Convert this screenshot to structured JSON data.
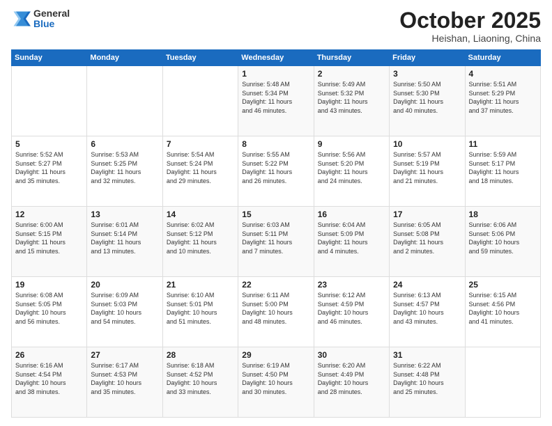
{
  "logo": {
    "general": "General",
    "blue": "Blue"
  },
  "header": {
    "month": "October 2025",
    "location": "Heishan, Liaoning, China"
  },
  "days_of_week": [
    "Sunday",
    "Monday",
    "Tuesday",
    "Wednesday",
    "Thursday",
    "Friday",
    "Saturday"
  ],
  "weeks": [
    [
      {
        "day": null,
        "info": null
      },
      {
        "day": null,
        "info": null
      },
      {
        "day": null,
        "info": null
      },
      {
        "day": "1",
        "info": "Sunrise: 5:48 AM\nSunset: 5:34 PM\nDaylight: 11 hours\nand 46 minutes."
      },
      {
        "day": "2",
        "info": "Sunrise: 5:49 AM\nSunset: 5:32 PM\nDaylight: 11 hours\nand 43 minutes."
      },
      {
        "day": "3",
        "info": "Sunrise: 5:50 AM\nSunset: 5:30 PM\nDaylight: 11 hours\nand 40 minutes."
      },
      {
        "day": "4",
        "info": "Sunrise: 5:51 AM\nSunset: 5:29 PM\nDaylight: 11 hours\nand 37 minutes."
      }
    ],
    [
      {
        "day": "5",
        "info": "Sunrise: 5:52 AM\nSunset: 5:27 PM\nDaylight: 11 hours\nand 35 minutes."
      },
      {
        "day": "6",
        "info": "Sunrise: 5:53 AM\nSunset: 5:25 PM\nDaylight: 11 hours\nand 32 minutes."
      },
      {
        "day": "7",
        "info": "Sunrise: 5:54 AM\nSunset: 5:24 PM\nDaylight: 11 hours\nand 29 minutes."
      },
      {
        "day": "8",
        "info": "Sunrise: 5:55 AM\nSunset: 5:22 PM\nDaylight: 11 hours\nand 26 minutes."
      },
      {
        "day": "9",
        "info": "Sunrise: 5:56 AM\nSunset: 5:20 PM\nDaylight: 11 hours\nand 24 minutes."
      },
      {
        "day": "10",
        "info": "Sunrise: 5:57 AM\nSunset: 5:19 PM\nDaylight: 11 hours\nand 21 minutes."
      },
      {
        "day": "11",
        "info": "Sunrise: 5:59 AM\nSunset: 5:17 PM\nDaylight: 11 hours\nand 18 minutes."
      }
    ],
    [
      {
        "day": "12",
        "info": "Sunrise: 6:00 AM\nSunset: 5:15 PM\nDaylight: 11 hours\nand 15 minutes."
      },
      {
        "day": "13",
        "info": "Sunrise: 6:01 AM\nSunset: 5:14 PM\nDaylight: 11 hours\nand 13 minutes."
      },
      {
        "day": "14",
        "info": "Sunrise: 6:02 AM\nSunset: 5:12 PM\nDaylight: 11 hours\nand 10 minutes."
      },
      {
        "day": "15",
        "info": "Sunrise: 6:03 AM\nSunset: 5:11 PM\nDaylight: 11 hours\nand 7 minutes."
      },
      {
        "day": "16",
        "info": "Sunrise: 6:04 AM\nSunset: 5:09 PM\nDaylight: 11 hours\nand 4 minutes."
      },
      {
        "day": "17",
        "info": "Sunrise: 6:05 AM\nSunset: 5:08 PM\nDaylight: 11 hours\nand 2 minutes."
      },
      {
        "day": "18",
        "info": "Sunrise: 6:06 AM\nSunset: 5:06 PM\nDaylight: 10 hours\nand 59 minutes."
      }
    ],
    [
      {
        "day": "19",
        "info": "Sunrise: 6:08 AM\nSunset: 5:05 PM\nDaylight: 10 hours\nand 56 minutes."
      },
      {
        "day": "20",
        "info": "Sunrise: 6:09 AM\nSunset: 5:03 PM\nDaylight: 10 hours\nand 54 minutes."
      },
      {
        "day": "21",
        "info": "Sunrise: 6:10 AM\nSunset: 5:01 PM\nDaylight: 10 hours\nand 51 minutes."
      },
      {
        "day": "22",
        "info": "Sunrise: 6:11 AM\nSunset: 5:00 PM\nDaylight: 10 hours\nand 48 minutes."
      },
      {
        "day": "23",
        "info": "Sunrise: 6:12 AM\nSunset: 4:59 PM\nDaylight: 10 hours\nand 46 minutes."
      },
      {
        "day": "24",
        "info": "Sunrise: 6:13 AM\nSunset: 4:57 PM\nDaylight: 10 hours\nand 43 minutes."
      },
      {
        "day": "25",
        "info": "Sunrise: 6:15 AM\nSunset: 4:56 PM\nDaylight: 10 hours\nand 41 minutes."
      }
    ],
    [
      {
        "day": "26",
        "info": "Sunrise: 6:16 AM\nSunset: 4:54 PM\nDaylight: 10 hours\nand 38 minutes."
      },
      {
        "day": "27",
        "info": "Sunrise: 6:17 AM\nSunset: 4:53 PM\nDaylight: 10 hours\nand 35 minutes."
      },
      {
        "day": "28",
        "info": "Sunrise: 6:18 AM\nSunset: 4:52 PM\nDaylight: 10 hours\nand 33 minutes."
      },
      {
        "day": "29",
        "info": "Sunrise: 6:19 AM\nSunset: 4:50 PM\nDaylight: 10 hours\nand 30 minutes."
      },
      {
        "day": "30",
        "info": "Sunrise: 6:20 AM\nSunset: 4:49 PM\nDaylight: 10 hours\nand 28 minutes."
      },
      {
        "day": "31",
        "info": "Sunrise: 6:22 AM\nSunset: 4:48 PM\nDaylight: 10 hours\nand 25 minutes."
      },
      {
        "day": null,
        "info": null
      }
    ]
  ]
}
